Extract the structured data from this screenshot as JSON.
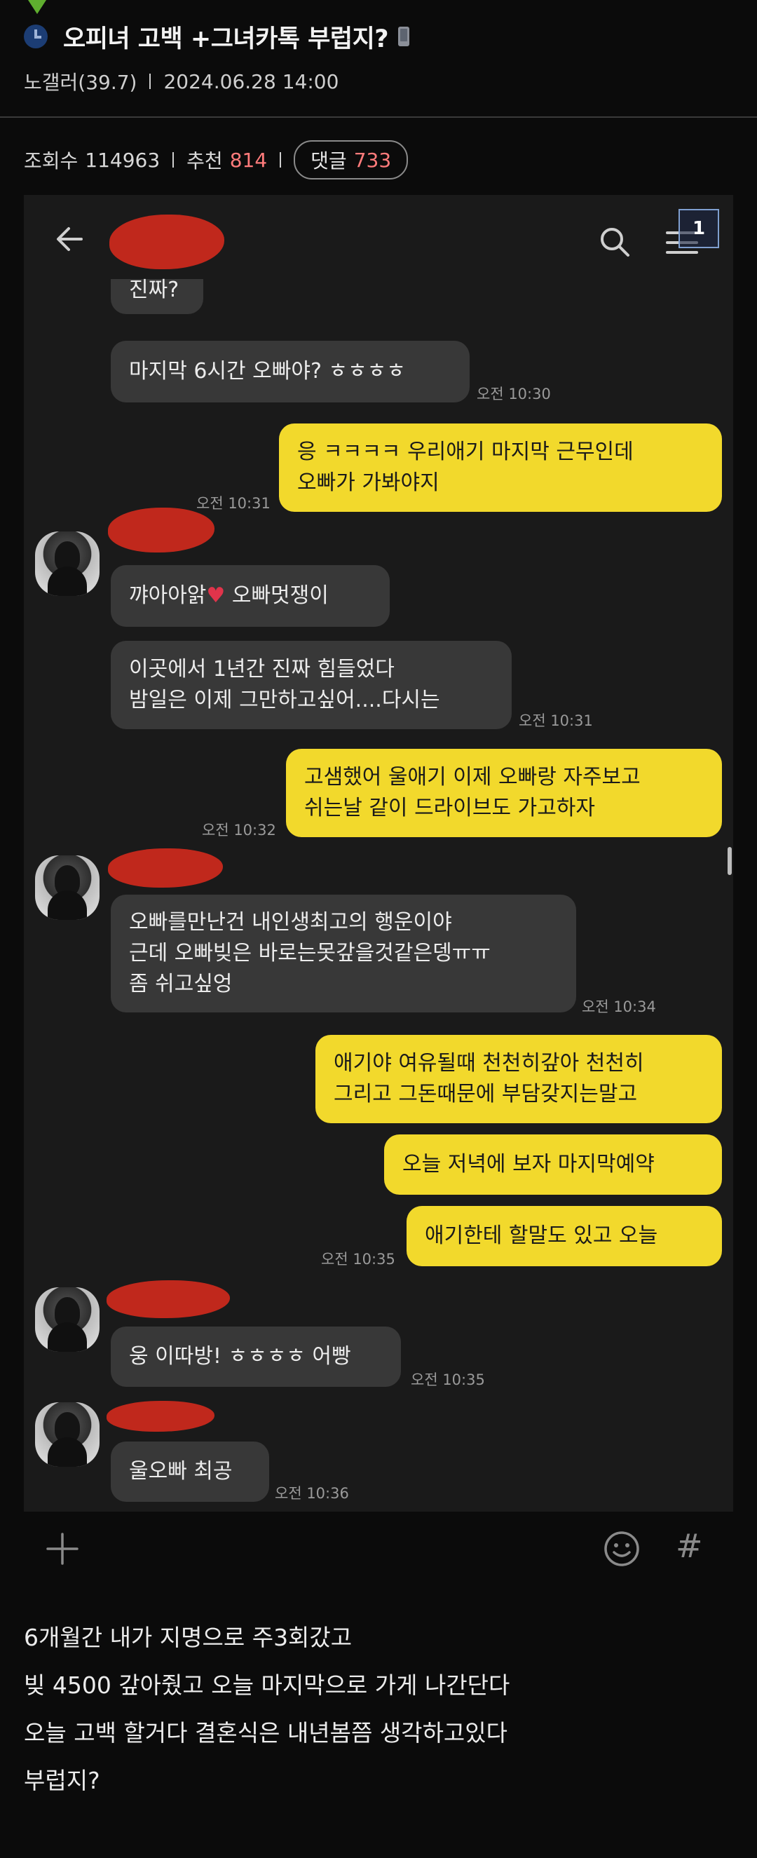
{
  "post": {
    "title": "오피녀 고백 +그녀카톡 부럽지?",
    "author": "노갤러(39.7)",
    "date": "2024.06.28 14:00",
    "views_label": "조회수",
    "views": "114963",
    "recommend_label": "추천",
    "recommend": "814",
    "comments_label": "댓글",
    "comments": "733",
    "icons": [
      "clock-icon",
      "phone-icon"
    ]
  },
  "chat": {
    "badge": "1",
    "icons": [
      "back-arrow-icon",
      "search-icon",
      "menu-icon",
      "plus-icon",
      "smile-icon",
      "hash-icon"
    ],
    "messages": [
      {
        "side": "recv",
        "lines": [
          "진짜?"
        ]
      },
      {
        "side": "recv",
        "lines": [
          "마지막 6시간 오빠야? ㅎㅎㅎㅎ"
        ],
        "time": "오전 10:30"
      },
      {
        "side": "sent",
        "lines": [
          "응 ㅋㅋㅋㅋ  우리애기 마지막 근무인데",
          "오빠가 가봐야지"
        ],
        "time": "오전 10:31"
      },
      {
        "side": "recv",
        "lines": [
          "꺄아아앍",
          "오빠멋쟁이"
        ]
      },
      {
        "side": "recv",
        "lines": [
          "이곳에서 1년간 진짜 힘들었다",
          "밤일은 이제 그만하고싶어....다시는"
        ],
        "time": "오전 10:31"
      },
      {
        "side": "sent",
        "lines": [
          "고샘했어 울애기 이제 오빠랑 자주보고",
          "쉬는날 같이 드라이브도 가고하자"
        ],
        "time": "오전 10:32"
      },
      {
        "side": "recv",
        "lines": [
          "오빠를만난건 내인생최고의 행운이야",
          "근데 오빠빚은 바로는못갚을것같은뎅ㅠㅠ",
          "좀 쉬고싶엉"
        ],
        "time": "오전 10:34"
      },
      {
        "side": "sent",
        "lines": [
          "애기야 여유될때 천천히갚아 천천히",
          "그리고 그돈때문에 부담갖지는말고"
        ]
      },
      {
        "side": "sent",
        "lines": [
          "오늘 저녁에 보자 마지막예약"
        ]
      },
      {
        "side": "sent",
        "lines": [
          "애기한테 할말도 있고 오늘"
        ],
        "time": "오전 10:35"
      },
      {
        "side": "recv",
        "lines": [
          "웅 이따방! ㅎㅎㅎㅎ 어빵"
        ],
        "time": "오전 10:35"
      },
      {
        "side": "recv",
        "lines": [
          "울오빠 최공"
        ],
        "time": "오전 10:36"
      }
    ]
  },
  "body": {
    "lines": [
      "6개월간 내가 지명으로 주3회갔고",
      "빚 4500 갚아줬고 오늘 마지막으로 가게 나간단다",
      "오늘 고백 할거다 결혼식은 내년봄쯤 생각하고있다",
      "부럽지?"
    ]
  },
  "colors": {
    "background": "#0b0b0b",
    "chat_background": "#1a1a1a",
    "received_bubble": "#383838",
    "sent_bubble": "#f2d92c",
    "accent_red": "#ff7b7b",
    "redaction": "#c0281c"
  }
}
